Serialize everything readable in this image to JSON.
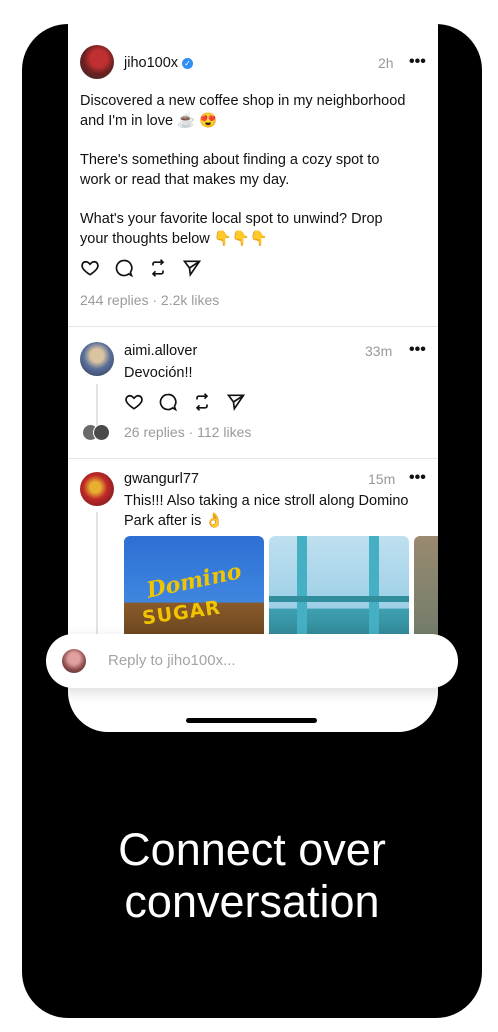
{
  "posts": [
    {
      "username": "jiho100x",
      "verified": true,
      "time": "2h",
      "text_lines": [
        "Discovered a new coffee shop in my neighborhood",
        "and I'm in love ☕️ 😍",
        "",
        "There's something about finding a cozy spot to",
        "work or read that makes my day.",
        "",
        "What's your favorite local spot to unwind? Drop",
        "your thoughts below 👇👇👇"
      ],
      "stats": "244 replies · 2.2k likes"
    },
    {
      "username": "aimi.allover",
      "time": "33m",
      "text": "Devoción!!",
      "stats": "26 replies · 112 likes"
    },
    {
      "username": "gwangurl77",
      "time": "15m",
      "text_lines": [
        "This!!! Also taking a nice stroll along Domino",
        "Park after is 👌"
      ],
      "photo_signs": [
        "Domino",
        "SUGAR"
      ]
    }
  ],
  "more_symbol": "•••",
  "reply": {
    "placeholder": "Reply to jiho100x..."
  },
  "tagline": [
    "Connect over",
    "conversation"
  ],
  "icons": [
    "heart-icon",
    "comment-icon",
    "repost-icon",
    "share-icon",
    "verified-icon",
    "more-icon"
  ],
  "colors": {
    "background": "#000000",
    "verified": "#2f8ff5",
    "muted": "#999999"
  }
}
